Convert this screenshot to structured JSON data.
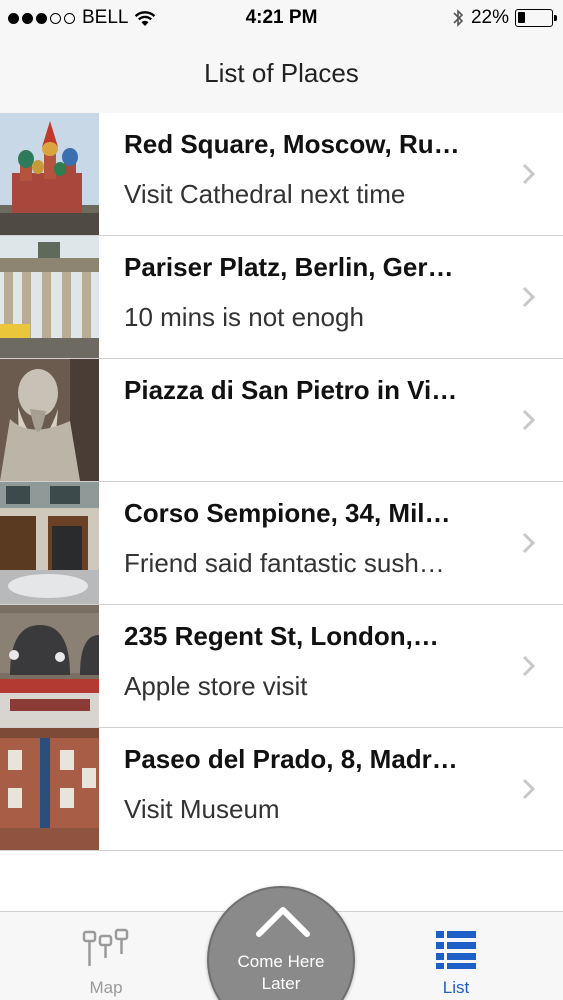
{
  "status_bar": {
    "signal_dots_filled": 3,
    "signal_dots_total": 5,
    "carrier": "BELL",
    "time": "4:21 PM",
    "battery_percent_label": "22%",
    "battery_level": 0.22,
    "wifi_icon": "wifi-icon",
    "bluetooth_icon": "bluetooth-icon"
  },
  "nav": {
    "title": "List of Places"
  },
  "places": [
    {
      "title": "Red Square, Moscow, Ru…",
      "subtitle": "Visit Cathedral next time",
      "photo": "st-basils-cathedral"
    },
    {
      "title": "Pariser Platz, Berlin, Ger…",
      "subtitle": "10 mins is not enogh",
      "photo": "brandenburg-gate"
    },
    {
      "title": "Piazza di San Pietro in Vi…",
      "subtitle": "",
      "photo": "moses-statue"
    },
    {
      "title": "Corso Sempione, 34, Mil…",
      "subtitle": "Friend said fantastic sush…",
      "photo": "street-storefront"
    },
    {
      "title": "235 Regent St, London,…",
      "subtitle": "Apple store visit",
      "photo": "apple-store-facade"
    },
    {
      "title": "Paseo del Prado, 8, Madr…",
      "subtitle": "Visit Museum",
      "photo": "museum-building"
    }
  ],
  "tab_bar": {
    "map_label": "Map",
    "list_label": "List",
    "center_button_label": "Come Here\nLater",
    "active_tab": "List",
    "colors": {
      "active": "#1f5fc8",
      "inactive": "#9a9a9a"
    }
  }
}
